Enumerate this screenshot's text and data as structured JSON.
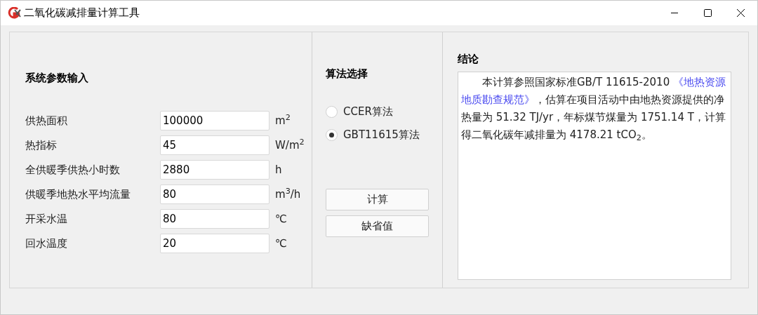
{
  "window": {
    "title": "二氧化碳减排量计算工具"
  },
  "params": {
    "heading": "系统参数输入",
    "fields": [
      {
        "label": "供热面积",
        "value": "100000",
        "unit": "m$^{2}$"
      },
      {
        "label": "热指标",
        "value": "45",
        "unit": "W/m$^{2}$"
      },
      {
        "label": "全供暖季供热小时数",
        "value": "2880",
        "unit": "h"
      },
      {
        "label": "供暖季地热水平均流量",
        "value": "80",
        "unit": "m$^{3}$/h"
      },
      {
        "label": "开采水温",
        "value": "80",
        "unit": "℃"
      },
      {
        "label": "回水温度",
        "value": "20",
        "unit": "℃"
      }
    ]
  },
  "algorithm": {
    "heading": "算法选择",
    "options": [
      {
        "label": "CCER算法",
        "selected": false
      },
      {
        "label": "GBT11615算法",
        "selected": true
      }
    ],
    "buttons": [
      "计算",
      "缺省值"
    ]
  },
  "conclusion": {
    "heading": "结论",
    "segments": [
      {
        "kind": "plain",
        "text": "本计算参照国家标准GB/T 11615-2010 "
      },
      {
        "kind": "link",
        "text": "《地热资源地质勘查规范》"
      },
      {
        "kind": "plain",
        "text": "，估算在项目活动中由地热资源提供的净热量为 51.32 TJ/yr，年标煤节煤量为 1751.14 T，计算得二氧化碳年减排量为 4178.21 tCO$_{2}$。"
      }
    ]
  }
}
